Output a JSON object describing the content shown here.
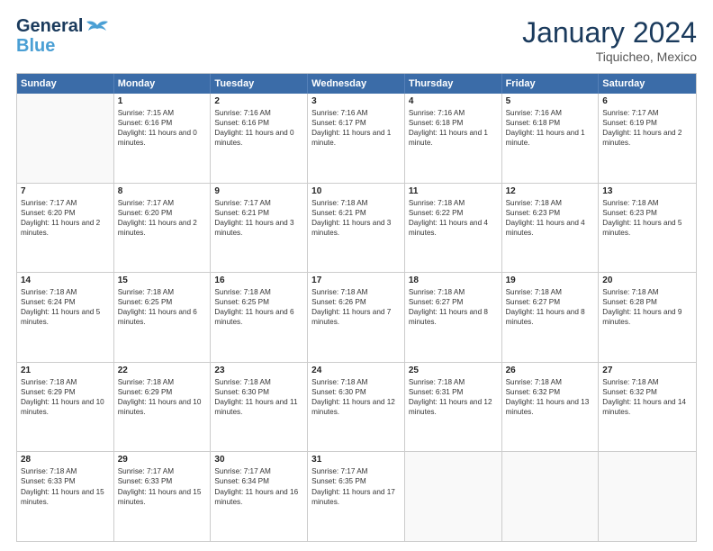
{
  "header": {
    "logo_line1": "General",
    "logo_line2": "Blue",
    "month_year": "January 2024",
    "location": "Tiquicheo, Mexico"
  },
  "days_of_week": [
    "Sunday",
    "Monday",
    "Tuesday",
    "Wednesday",
    "Thursday",
    "Friday",
    "Saturday"
  ],
  "weeks": [
    [
      {
        "day": "",
        "empty": true
      },
      {
        "day": "1",
        "sunrise": "7:15 AM",
        "sunset": "6:16 PM",
        "daylight": "11 hours and 0 minutes."
      },
      {
        "day": "2",
        "sunrise": "7:16 AM",
        "sunset": "6:16 PM",
        "daylight": "11 hours and 0 minutes."
      },
      {
        "day": "3",
        "sunrise": "7:16 AM",
        "sunset": "6:17 PM",
        "daylight": "11 hours and 1 minute."
      },
      {
        "day": "4",
        "sunrise": "7:16 AM",
        "sunset": "6:18 PM",
        "daylight": "11 hours and 1 minute."
      },
      {
        "day": "5",
        "sunrise": "7:16 AM",
        "sunset": "6:18 PM",
        "daylight": "11 hours and 1 minute."
      },
      {
        "day": "6",
        "sunrise": "7:17 AM",
        "sunset": "6:19 PM",
        "daylight": "11 hours and 2 minutes."
      }
    ],
    [
      {
        "day": "7",
        "sunrise": "7:17 AM",
        "sunset": "6:20 PM",
        "daylight": "11 hours and 2 minutes."
      },
      {
        "day": "8",
        "sunrise": "7:17 AM",
        "sunset": "6:20 PM",
        "daylight": "11 hours and 2 minutes."
      },
      {
        "day": "9",
        "sunrise": "7:17 AM",
        "sunset": "6:21 PM",
        "daylight": "11 hours and 3 minutes."
      },
      {
        "day": "10",
        "sunrise": "7:18 AM",
        "sunset": "6:21 PM",
        "daylight": "11 hours and 3 minutes."
      },
      {
        "day": "11",
        "sunrise": "7:18 AM",
        "sunset": "6:22 PM",
        "daylight": "11 hours and 4 minutes."
      },
      {
        "day": "12",
        "sunrise": "7:18 AM",
        "sunset": "6:23 PM",
        "daylight": "11 hours and 4 minutes."
      },
      {
        "day": "13",
        "sunrise": "7:18 AM",
        "sunset": "6:23 PM",
        "daylight": "11 hours and 5 minutes."
      }
    ],
    [
      {
        "day": "14",
        "sunrise": "7:18 AM",
        "sunset": "6:24 PM",
        "daylight": "11 hours and 5 minutes."
      },
      {
        "day": "15",
        "sunrise": "7:18 AM",
        "sunset": "6:25 PM",
        "daylight": "11 hours and 6 minutes."
      },
      {
        "day": "16",
        "sunrise": "7:18 AM",
        "sunset": "6:25 PM",
        "daylight": "11 hours and 6 minutes."
      },
      {
        "day": "17",
        "sunrise": "7:18 AM",
        "sunset": "6:26 PM",
        "daylight": "11 hours and 7 minutes."
      },
      {
        "day": "18",
        "sunrise": "7:18 AM",
        "sunset": "6:27 PM",
        "daylight": "11 hours and 8 minutes."
      },
      {
        "day": "19",
        "sunrise": "7:18 AM",
        "sunset": "6:27 PM",
        "daylight": "11 hours and 8 minutes."
      },
      {
        "day": "20",
        "sunrise": "7:18 AM",
        "sunset": "6:28 PM",
        "daylight": "11 hours and 9 minutes."
      }
    ],
    [
      {
        "day": "21",
        "sunrise": "7:18 AM",
        "sunset": "6:29 PM",
        "daylight": "11 hours and 10 minutes."
      },
      {
        "day": "22",
        "sunrise": "7:18 AM",
        "sunset": "6:29 PM",
        "daylight": "11 hours and 10 minutes."
      },
      {
        "day": "23",
        "sunrise": "7:18 AM",
        "sunset": "6:30 PM",
        "daylight": "11 hours and 11 minutes."
      },
      {
        "day": "24",
        "sunrise": "7:18 AM",
        "sunset": "6:30 PM",
        "daylight": "11 hours and 12 minutes."
      },
      {
        "day": "25",
        "sunrise": "7:18 AM",
        "sunset": "6:31 PM",
        "daylight": "11 hours and 12 minutes."
      },
      {
        "day": "26",
        "sunrise": "7:18 AM",
        "sunset": "6:32 PM",
        "daylight": "11 hours and 13 minutes."
      },
      {
        "day": "27",
        "sunrise": "7:18 AM",
        "sunset": "6:32 PM",
        "daylight": "11 hours and 14 minutes."
      }
    ],
    [
      {
        "day": "28",
        "sunrise": "7:18 AM",
        "sunset": "6:33 PM",
        "daylight": "11 hours and 15 minutes."
      },
      {
        "day": "29",
        "sunrise": "7:17 AM",
        "sunset": "6:33 PM",
        "daylight": "11 hours and 15 minutes."
      },
      {
        "day": "30",
        "sunrise": "7:17 AM",
        "sunset": "6:34 PM",
        "daylight": "11 hours and 16 minutes."
      },
      {
        "day": "31",
        "sunrise": "7:17 AM",
        "sunset": "6:35 PM",
        "daylight": "11 hours and 17 minutes."
      },
      {
        "day": "",
        "empty": true
      },
      {
        "day": "",
        "empty": true
      },
      {
        "day": "",
        "empty": true
      }
    ]
  ]
}
